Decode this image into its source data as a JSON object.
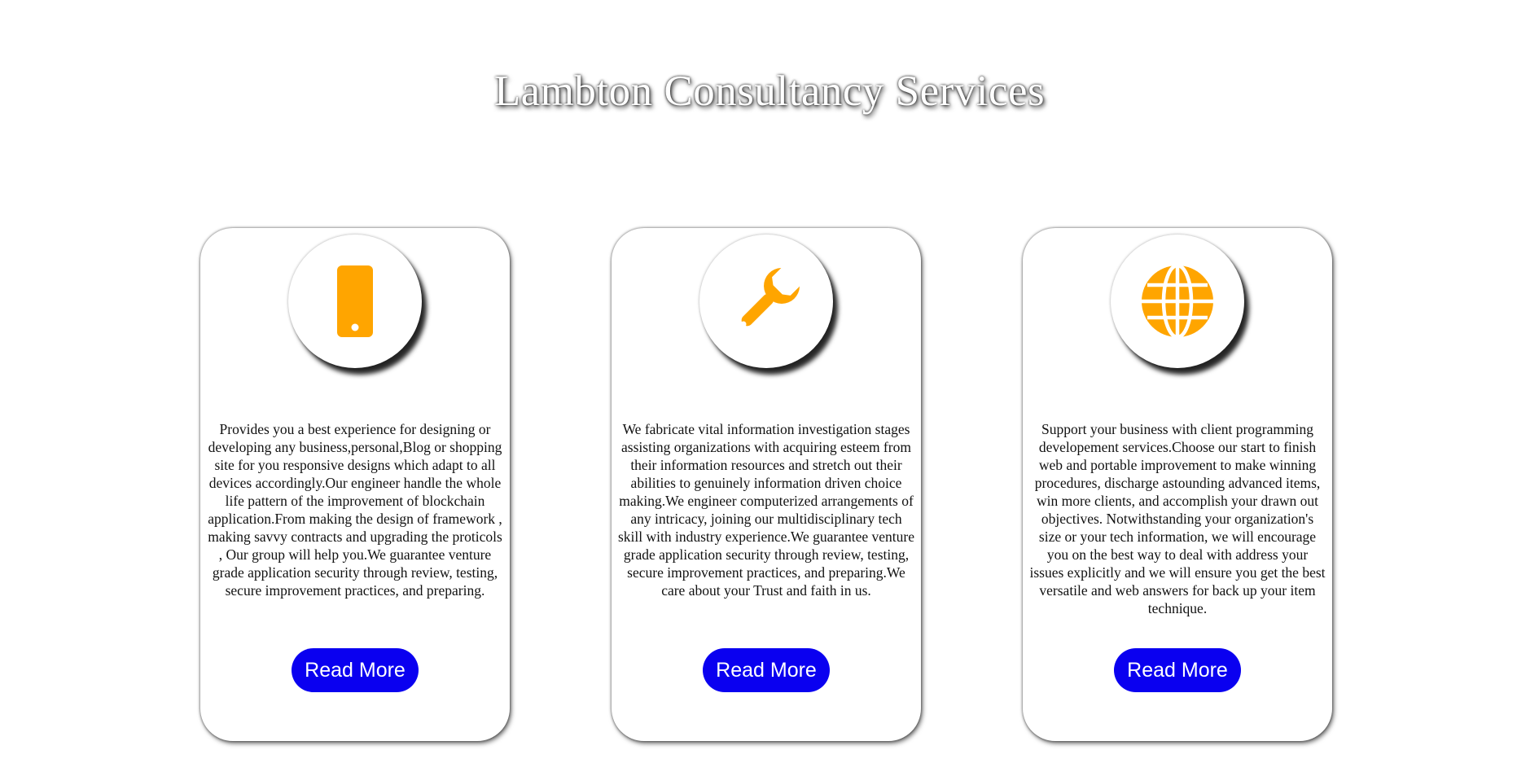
{
  "header": {
    "title": "Lambton Consultancy Services"
  },
  "colors": {
    "icon": "#FFA500",
    "button": "#0A00F0",
    "button_text": "#FFFFFF"
  },
  "cards": [
    {
      "icon": "mobile-phone-icon",
      "text": "Provides you a best experience for designing or developing any business,personal,Blog or shopping site for you responsive designs which adapt to all devices accordingly.Our engineer handle the whole life pattern of the improvement of blockchain application.From making the design of framework , making savvy contracts and upgrading the proticols , Our group will help you.We guarantee venture grade application security through review, testing, secure improvement practices, and preparing.",
      "button_label": "Read More"
    },
    {
      "icon": "wrench-icon",
      "text": "We fabricate vital information investigation stages assisting organizations with acquiring esteem from their information resources and stretch out their abilities to genuinely information driven choice making.We engineer computerized arrangements of any intricacy, joining our multidisciplinary tech skill with industry experience.We guarantee venture grade application security through review, testing, secure improvement practices, and preparing.We care about your Trust and faith in us.",
      "button_label": "Read More"
    },
    {
      "icon": "globe-icon",
      "text": "Support your business with client programming developement services.Choose our start to finish web and portable improvement to make winning procedures, discharge astounding advanced items, win more clients, and accomplish your drawn out objectives. Notwithstanding your organization's size or your tech information, we will encourage you on the best way to deal with address your issues explicitly and we will ensure you get the best versatile and web answers for back up your item technique.",
      "button_label": "Read More"
    }
  ]
}
